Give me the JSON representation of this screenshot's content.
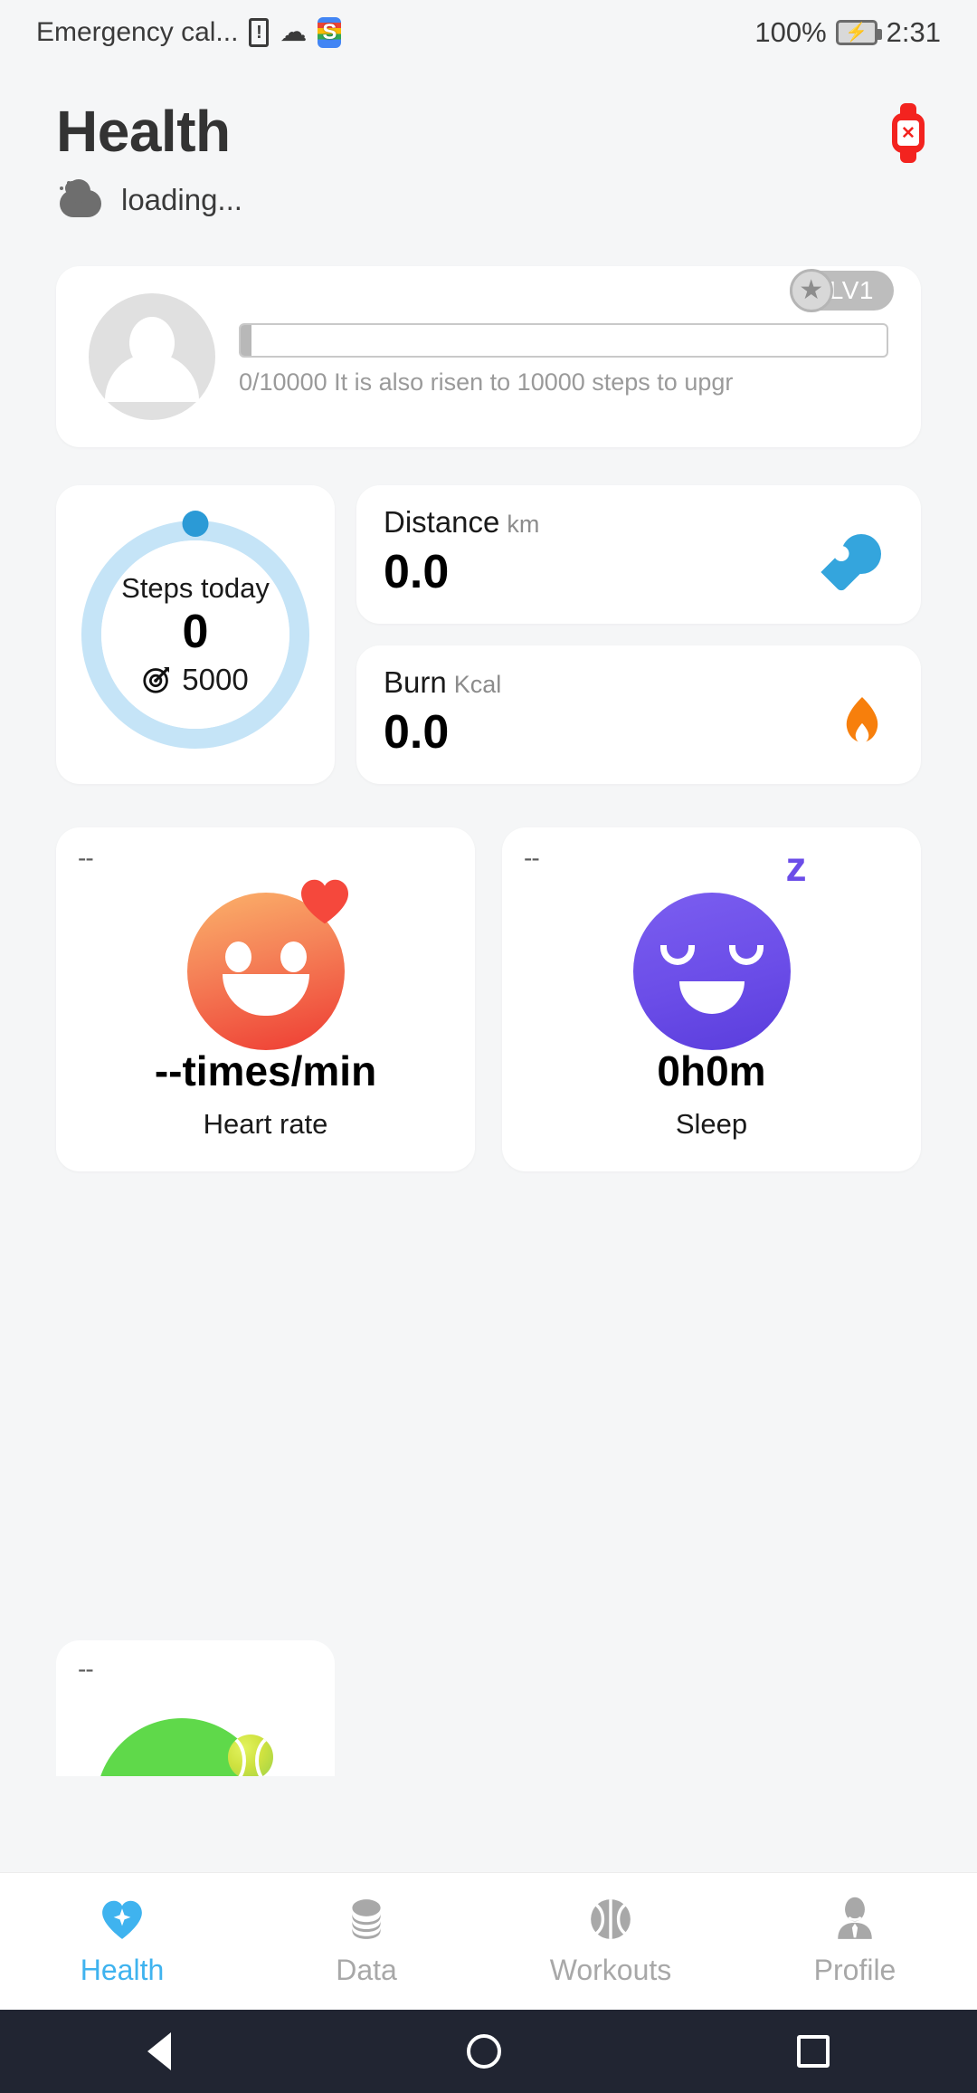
{
  "status_bar": {
    "carrier": "Emergency cal...",
    "sim_icon": "sim-alert-icon",
    "wifi_icon": "wifi-icon",
    "app_icon": "s-app-icon",
    "battery_percent": "100%",
    "battery_icon": "battery-charging-icon",
    "time": "2:31"
  },
  "header": {
    "title": "Health",
    "weather_icon": "partly-cloudy-icon",
    "weather_status": "loading...",
    "device_icon": "band-disconnected-icon"
  },
  "profile": {
    "avatar_icon": "user-avatar-icon",
    "level_badge": "LV1",
    "star_icon": "star-icon",
    "progress_text": "0/10000 It is also risen to 10000 steps to upgr",
    "progress_percent": 0
  },
  "steps": {
    "label": "Steps today",
    "value": "0",
    "goal_icon": "target-icon",
    "goal": "5000",
    "ring_color": "#c5e4f7",
    "dot_color": "#2b9ad6"
  },
  "stats": [
    {
      "title": "Distance",
      "unit": "km",
      "value": "0.0",
      "icon": "location-pin-icon",
      "color": "#34a5dd"
    },
    {
      "title": "Burn",
      "unit": "Kcal",
      "value": "0.0",
      "icon": "flame-icon",
      "color": "#f77f0c"
    }
  ],
  "tiles": [
    {
      "dash": "--",
      "face_icon": "smiley-face-icon",
      "badge_icon": "heart-icon",
      "value": "--times/min",
      "label": "Heart rate"
    },
    {
      "dash": "--",
      "face_icon": "sleepy-face-icon",
      "badge_icon": "z-sleep-icon",
      "value": "0h0m",
      "label": "Sleep"
    }
  ],
  "partial_tile": {
    "dash": "--",
    "icon": "tennis-ball-icon"
  },
  "bottom_nav": {
    "items": [
      {
        "label": "Health",
        "icon": "heart-health-icon",
        "active": true
      },
      {
        "label": "Data",
        "icon": "coins-stack-icon",
        "active": false
      },
      {
        "label": "Workouts",
        "icon": "basketball-icon",
        "active": false
      },
      {
        "label": "Profile",
        "icon": "person-tie-icon",
        "active": false
      }
    ],
    "active_color": "#3fb3ef",
    "inactive_color": "#a8a8a8"
  },
  "system_bar": {
    "back": "back-triangle-icon",
    "home": "home-circle-icon",
    "recents": "recents-square-icon"
  }
}
